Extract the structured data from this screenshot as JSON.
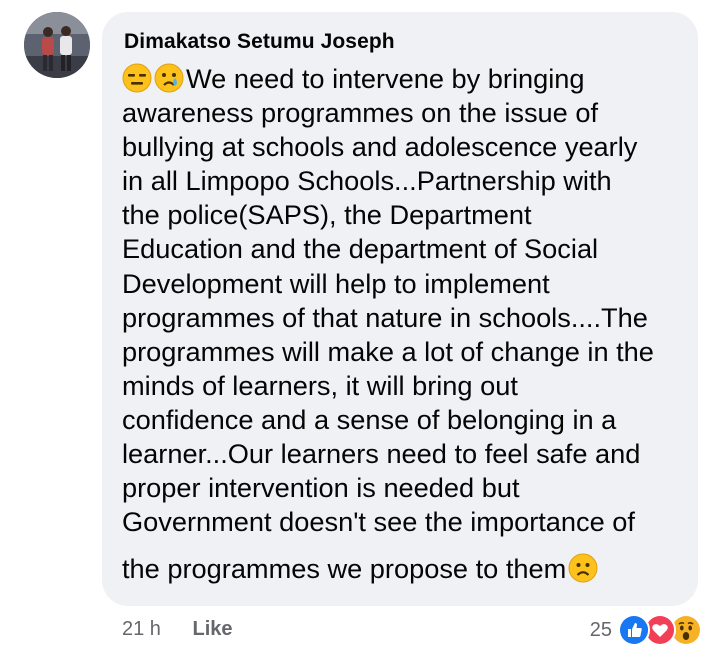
{
  "comment": {
    "author": "Dimakatso Setumu Joseph",
    "lines": [
      "We need to intervene by bringing",
      "awareness programmes on the issue of",
      "bullying at schools and adolescence yearly",
      "in all Limpopo Schools...Partnership with",
      "the police(SAPS), the Department",
      "Education and the department of Social",
      "Development will help to implement",
      "programmes of that nature in schools....The",
      "programmes will make a lot of change in the",
      "minds of learners, it will bring out",
      "confidence and a sense of belonging in a",
      "learner...Our learners need to feel safe and",
      "proper intervention is needed but",
      "Government doesn't see the importance of",
      "the programmes we propose to them"
    ],
    "leading_emojis": [
      "expressionless-face-emoji",
      "crying-face-emoji"
    ],
    "trailing_emoji": "frowning-face-emoji"
  },
  "meta": {
    "time": "21 h",
    "like_label": "Like"
  },
  "reactions": {
    "count": "25",
    "icons": [
      "like-reaction-icon",
      "love-reaction-icon",
      "wow-reaction-icon"
    ],
    "colors": {
      "like": "#1877f2",
      "love": "#f33e58",
      "wow": "#f7b125"
    }
  }
}
